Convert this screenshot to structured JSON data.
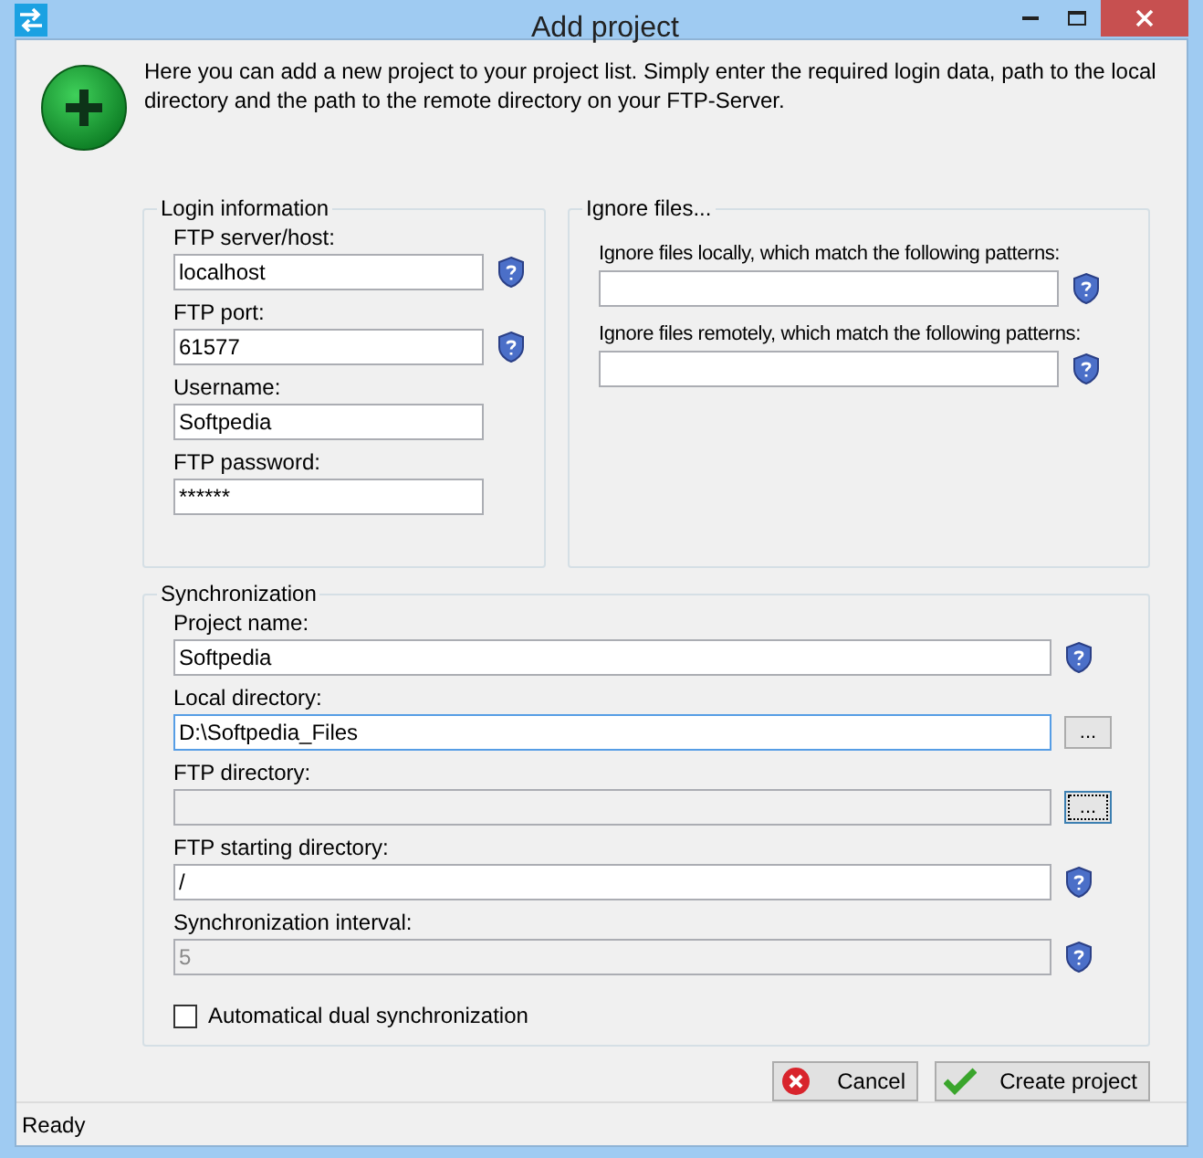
{
  "window": {
    "title": "Add project"
  },
  "intro": "Here you can add a new project to your project list. Simply enter the required login data, path to the local directory and the path to the remote directory on your FTP-Server.",
  "groups": [
    {
      "title": "Login information",
      "fields": [
        {
          "label": "FTP server/host:",
          "value": "localhost",
          "disabled": false,
          "focused": false,
          "help": true
        },
        {
          "label": "FTP port:",
          "value": "61577",
          "disabled": false,
          "focused": false,
          "help": true
        },
        {
          "label": "Username:",
          "value": "Softpedia",
          "disabled": false,
          "focused": false,
          "help": false
        },
        {
          "label": "FTP password:",
          "value": "******",
          "disabled": false,
          "focused": false,
          "help": false
        }
      ]
    },
    {
      "title": "Ignore files...",
      "fields": [
        {
          "label": "Ignore files locally, which match the following patterns:",
          "disabled": false,
          "focused": false,
          "help": true
        },
        {
          "label": "Ignore files remotely, which match the following patterns:",
          "disabled": false,
          "focused": false,
          "help": true
        }
      ]
    },
    {
      "title": "Synchronization",
      "fields": [
        {
          "label": "Project name:",
          "value": "Softpedia",
          "disabled": false,
          "focused": false,
          "help": true
        },
        {
          "label": "Local directory:",
          "value": "D:\\Softpedia_Files",
          "disabled": false,
          "focused": true,
          "help": false,
          "browse": {
            "label": "...",
            "focused": false
          }
        },
        {
          "label": "FTP directory:",
          "disabled": true,
          "focused": false,
          "help": false,
          "browse": {
            "label": "...",
            "focused": true
          }
        },
        {
          "label": "FTP starting directory:",
          "value": "/",
          "disabled": false,
          "focused": false,
          "help": true
        },
        {
          "label": "Synchronization interval:",
          "value": "5",
          "disabled": true,
          "focused": false,
          "help": true
        }
      ],
      "checkbox": {
        "label": "Automatical dual synchronization",
        "checked": false
      }
    }
  ],
  "buttons": [
    {
      "label": "Cancel",
      "kind": "cancel"
    },
    {
      "label": "Create project",
      "kind": "create"
    }
  ],
  "status_bar": "Ready"
}
